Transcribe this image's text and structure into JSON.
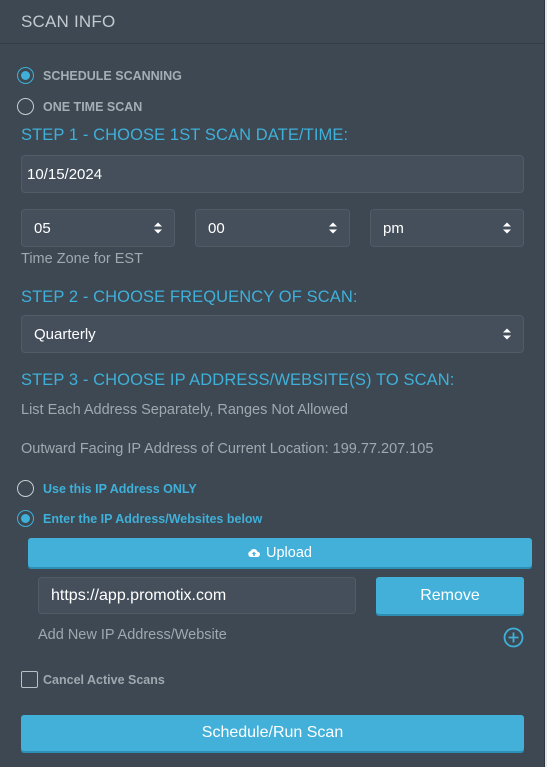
{
  "panel": {
    "title": "SCAN INFO"
  },
  "scan_mode": {
    "options": [
      {
        "label": "SCHEDULE SCANNING",
        "checked": true
      },
      {
        "label": "ONE TIME SCAN",
        "checked": false
      }
    ]
  },
  "step1": {
    "heading": "STEP 1 - CHOOSE 1ST SCAN DATE/TIME:",
    "date_value": "10/15/2024",
    "hour": "05",
    "minute": "00",
    "ampm": "pm",
    "timezone_note": "Time Zone for EST"
  },
  "step2": {
    "heading": "STEP 2 - CHOOSE FREQUENCY OF SCAN:",
    "frequency": "Quarterly"
  },
  "step3": {
    "heading": "STEP 3 - CHOOSE IP ADDRESS/WEBSITE(S) TO SCAN:",
    "note": "List Each Address Separately, Ranges Not Allowed",
    "current_ip_text": "Outward Facing IP Address of Current Location: 199.77.207.105",
    "options": [
      {
        "label": "Use this IP Address ONLY",
        "checked": false
      },
      {
        "label": "Enter the IP Address/Websites below",
        "checked": true
      }
    ],
    "upload_label": "Upload",
    "addresses": [
      {
        "value": "https://app.promotix.com",
        "remove_label": "Remove"
      }
    ],
    "add_new_label": "Add New IP Address/Website"
  },
  "cancel_active": {
    "label": "Cancel Active Scans",
    "checked": false
  },
  "submit_label": "Schedule/Run Scan",
  "colors": {
    "accent": "#42b0d9",
    "panel_bg": "#3d4852",
    "field_bg": "#454f5b"
  }
}
